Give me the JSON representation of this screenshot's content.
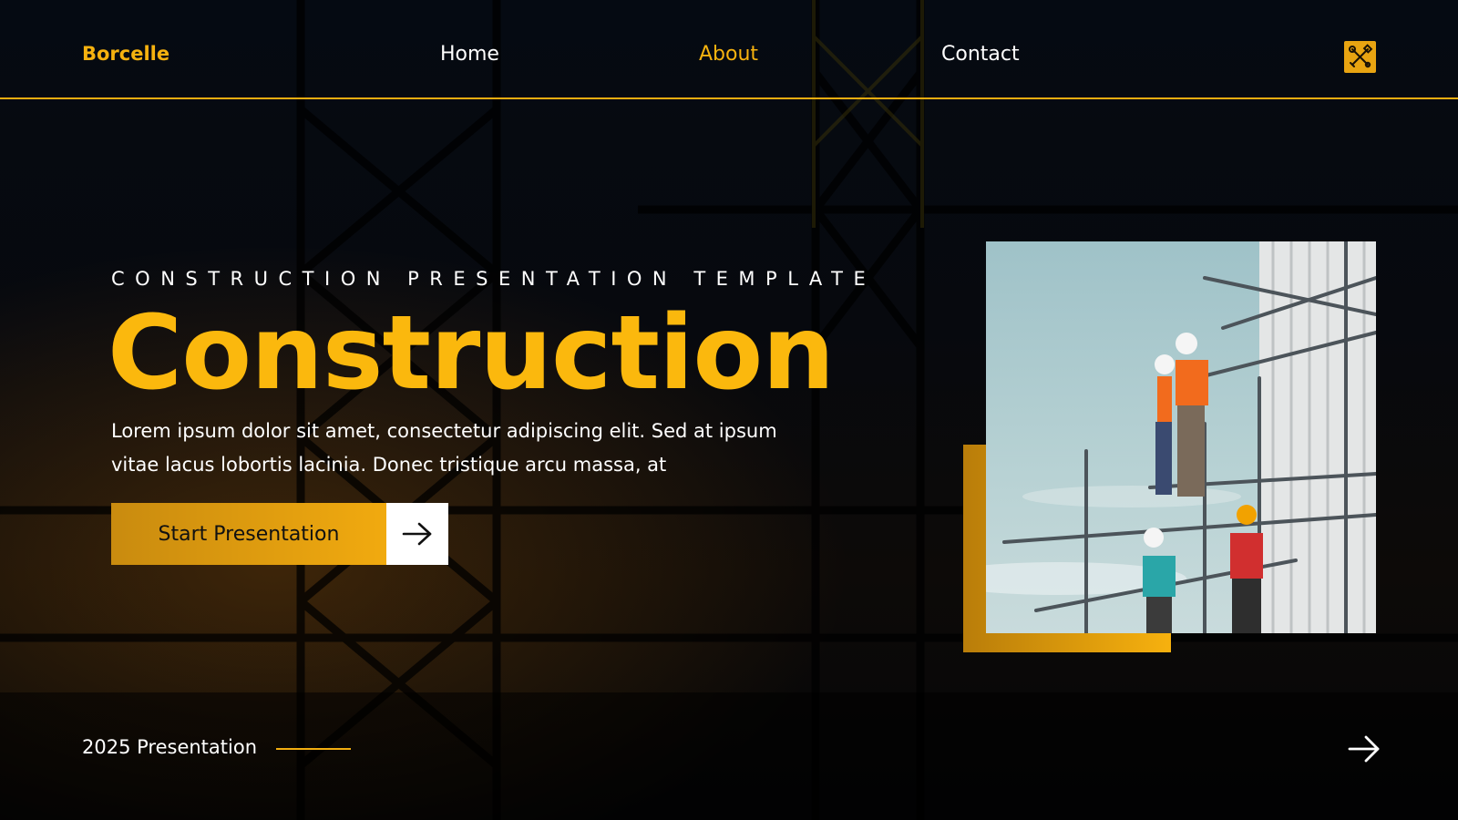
{
  "nav": {
    "brand": "Borcelle",
    "links": [
      {
        "label": "Home",
        "active": false
      },
      {
        "label": "About",
        "active": true
      },
      {
        "label": "Contact",
        "active": false
      }
    ],
    "tool_icon": "tools-icon"
  },
  "hero": {
    "kicker": "CONSTRUCTION PRESENTATION TEMPLATE",
    "title": "Construction",
    "description": "Lorem ipsum dolor sit amet, consectetur adipiscing elit. Sed at ipsum vitae lacus lobortis lacinia. Donec tristique arcu massa, at",
    "cta_label": "Start Presentation",
    "cta_icon": "arrow-right-icon"
  },
  "footer": {
    "label": "2025 Presentation",
    "next_icon": "arrow-right-icon"
  },
  "colors": {
    "accent": "#f6b20f",
    "background": "#04070d",
    "text": "#ffffff"
  }
}
